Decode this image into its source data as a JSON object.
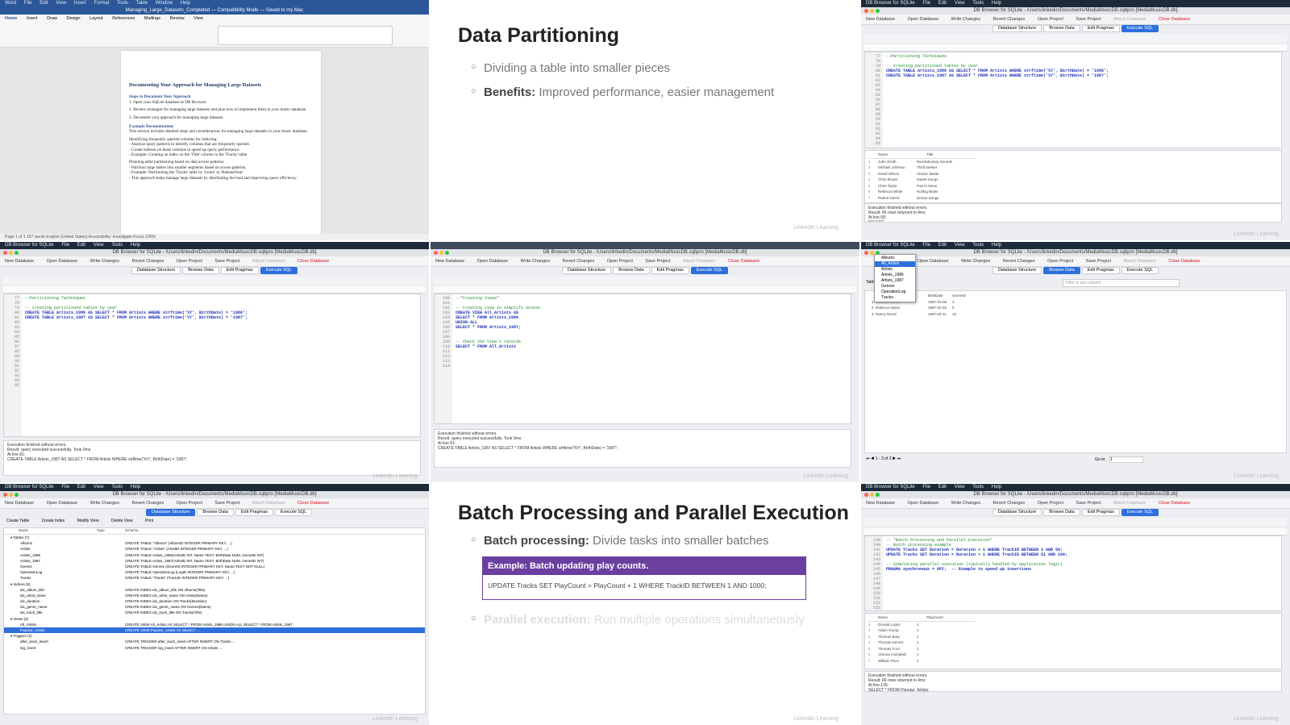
{
  "app": {
    "mac_menu": [
      "DB Browser for SQLite",
      "File",
      "Edit",
      "View",
      "Tools",
      "Help"
    ],
    "window_title": "DB Browser for SQLite - /Users/linkedin/Documents/MediaMusicDB.sqbpro [MediaMusicDB.db]",
    "toolbar": [
      "New Database",
      "Open Database",
      "Write Changes",
      "Revert Changes",
      "Open Project",
      "Save Project",
      "Attach Database",
      "Close Database"
    ],
    "tabs": [
      "Database Structure",
      "Browse Data",
      "Edit Pragmas",
      "Execute SQL"
    ],
    "watermark": "LinkedIn Learning"
  },
  "word": {
    "menu": [
      "Word",
      "File",
      "Edit",
      "View",
      "Insert",
      "Format",
      "Tools",
      "Table",
      "Window",
      "Help"
    ],
    "title": "Managing_Large_Datasets_Completed — Compatibility Mode — Saved to my Mac",
    "ribbon_tabs": [
      "Home",
      "Insert",
      "Draw",
      "Design",
      "Layout",
      "References",
      "Mailings",
      "Review",
      "View"
    ],
    "doc_title": "Documenting Your Approach for Managing Large Datasets",
    "doc_lines": [
      "Steps to Document Your Approach",
      "1. Open your SQLite database in DB Browser.",
      "2. Review strategies for managing large datasets and plan how to implement them in your music database.",
      "3. Document your approach for managing large datasets.",
      "Example Documentation",
      "This section includes detailed steps and considerations for managing large datasets in your music database.",
      "Identifying frequently queried columns for indexing:",
      "- Analyze query patterns to identify columns that are frequently queried.",
      "- Create indexes on these columns to speed up query performance.",
      "- Example: Creating an index on the 'Title' column in the 'Tracks' table.",
      "Planning table partitioning based on data access patterns:",
      "- Partition large tables into smaller segments based on access patterns.",
      "- Example: Partitioning the 'Tracks' table by 'Genre' or 'ReleaseYear'.",
      "- This approach helps manage large datasets by distributing the load and improving query efficiency."
    ],
    "status": "Page 1 of 1    167 words    English (United States)    Accessibility: Investigate    Focus    100%"
  },
  "slide1": {
    "title": "Data Partitioning",
    "bullet1": "Dividing a table into smaller pieces",
    "bullet2_label": "Benefits:",
    "bullet2_text": "Improved performance, easier management"
  },
  "slide2": {
    "title": "Batch Processing and Parallel Execution",
    "bullet1_label": "Batch processing:",
    "bullet1_text": "Divide tasks into smaller batches",
    "example_title": "Example: Batch updating play counts.",
    "example_code": "UPDATE Tracks SET PlayCount = PlayCount + 1 WHERE TrackID BETWEEN 1 AND 1000;",
    "bullet2_label": "Parallel execution:",
    "bullet2_text": "Run multiple operations simultaneously"
  },
  "editor_tr": {
    "lines": [
      "77",
      "78",
      "79",
      "80",
      "81",
      "82",
      "83",
      "84",
      "85",
      "86",
      "87",
      "88",
      "89",
      "90",
      "91",
      "92",
      "93",
      "94",
      "95"
    ],
    "code": [
      {
        "t": "c",
        "v": "--Partitioning Techniques"
      },
      {
        "t": "",
        "v": ""
      },
      {
        "t": "c",
        "v": "-- Creating partitioned tables by year"
      },
      {
        "t": "k",
        "v": "CREATE TABLE Artists_1986 AS SELECT * FROM Artists WHERE strftime('%Y', BirthDate) = '1986';"
      },
      {
        "t": "k",
        "v": "CREATE TABLE Artists_1987 AS SELECT * FROM Artists WHERE strftime('%Y', BirthDate) = '1987';"
      }
    ],
    "result_cols": [
      "Name",
      "Title"
    ],
    "result_rows": [
      [
        "John Smith",
        "Revolutionary Sounds"
      ],
      [
        "Michael Johnson",
        "Thrill Seeker"
      ],
      [
        "David Wilson",
        "Classic Beats"
      ],
      [
        "Chris Brown",
        "Sweet Songs"
      ],
      [
        "Chris Taylor",
        "Pop to Move"
      ],
      [
        "Rebecca White",
        "Rolling Beats"
      ],
      [
        "Robert Harris",
        "Dream Songs"
      ]
    ],
    "message": "Execution finished without errors.\nResult: 66 rows returned in 4ms\nAt line 68:\nSELECT\n            Artists.Name,"
  },
  "editor_ml": {
    "lines": [
      "77",
      "78",
      "79",
      "80",
      "81",
      "82",
      "83",
      "84",
      "85",
      "86",
      "87",
      "88",
      "89",
      "90",
      "91",
      "92",
      "93",
      "94",
      "95"
    ],
    "code": [
      {
        "t": "c",
        "v": "--Partitioning Techniques"
      },
      {
        "t": "",
        "v": ""
      },
      {
        "t": "c",
        "v": "-- Creating partitioned tables by year"
      },
      {
        "t": "k",
        "v": "CREATE TABLE Artists_1986 AS SELECT * FROM Artists WHERE strftime('%Y', BirthDate) = '1986';"
      },
      {
        "t": "k",
        "v": "CREATE TABLE Artists_1987 AS SELECT * FROM Artists WHERE strftime('%Y', BirthDate) = '1987';"
      }
    ],
    "message": "Execution finished without errors.\nResult: query executed successfully. Took 0ms\nAt line 81:\nCREATE TABLE Artists_1987 AS SELECT * FROM Artists WHERE strftime('%Y', BirthDate) = '1987';"
  },
  "editor_mc": {
    "lines": [
      "100",
      "101",
      "102",
      "103",
      "104",
      "105",
      "106",
      "107",
      "108",
      "109",
      "110",
      "111",
      "112",
      "113",
      "114"
    ],
    "code": [
      {
        "t": "c",
        "v": "--\"Creating Views\""
      },
      {
        "t": "",
        "v": ""
      },
      {
        "t": "c",
        "v": "-- Creating view to simplify access"
      },
      {
        "t": "k",
        "v": "CREATE VIEW All_Artists AS"
      },
      {
        "t": "k",
        "v": "SELECT * FROM Artists_1986"
      },
      {
        "t": "k",
        "v": "UNION ALL"
      },
      {
        "t": "k",
        "v": "SELECT * FROM Artists_1987;"
      },
      {
        "t": "",
        "v": ""
      },
      {
        "t": "",
        "v": ""
      },
      {
        "t": "c",
        "v": "-- Check the View's records"
      },
      {
        "t": "k",
        "v": "SELECT * FROM All_Artists"
      }
    ],
    "message": "Execution finished without errors.\nResult: query executed successfully. Took 0ms\nAt line 81:\nCREATE TABLE Artists_1987 AS SELECT * FROM Artists WHERE strftime('%Y', BirthDate) = '1987';"
  },
  "browse_mr": {
    "table_label": "Table:",
    "tables": [
      "Albums",
      "All_Artists",
      "Artists",
      "Artists_1986",
      "Artists_1987",
      "Genres",
      "OperationLog",
      "Tracks"
    ],
    "filter_placeholder": "Filter in any column",
    "cols": [
      "",
      "BirthDate",
      "GenreID"
    ],
    "rows": [
      [
        "1  Amanda White",
        "1987-01-08",
        "3"
      ],
      [
        "2  Rebecca Ward",
        "1987-02-26",
        "5"
      ],
      [
        "3  Nancy Wood",
        "1987-03-11",
        "10"
      ]
    ],
    "pager": "1 - 3 of 3",
    "goto_label": "Go to:",
    "goto_value": "1"
  },
  "structure_bl": {
    "buttons": [
      "Create Table",
      "Create Index",
      "Modify View",
      "Delete View",
      "Print"
    ],
    "cols": [
      "Name",
      "Type",
      "Schema"
    ],
    "rows": [
      [
        "Tables (7)",
        "",
        ""
      ],
      [
        "Albums",
        "",
        "CREATE TABLE \"Albums\" (AlbumID INTEGER PRIMARY KEY, ...)"
      ],
      [
        "Artists",
        "",
        "CREATE TABLE \"Artists\" (ArtistID INTEGER PRIMARY KEY, ...)"
      ],
      [
        "Artists_1986",
        "",
        "CREATE TABLE Artists_1986(ArtistID INT, Name TEXT, BirthDate NUM, GenreID INT)"
      ],
      [
        "Artists_1987",
        "",
        "CREATE TABLE Artists_1987(ArtistID INT, Name TEXT, BirthDate NUM, GenreID INT)"
      ],
      [
        "Genres",
        "",
        "CREATE TABLE Genres (GenreID INTEGER PRIMARY KEY, Name TEXT NOT NULL)"
      ],
      [
        "OperationLog",
        "",
        "CREATE TABLE OperationLog (LogID INTEGER PRIMARY KEY, ...)"
      ],
      [
        "Tracks",
        "",
        "CREATE TABLE \"Tracks\" (TrackID INTEGER PRIMARY KEY, ...)"
      ],
      [
        "Indices (5)",
        "",
        ""
      ],
      [
        "idx_album_title",
        "",
        "CREATE INDEX idx_album_title ON Albums(Title)"
      ],
      [
        "idx_artist_name",
        "",
        "CREATE INDEX idx_artist_name ON Artists(Name)"
      ],
      [
        "idx_duration",
        "",
        "CREATE INDEX idx_duration ON Tracks(Duration)"
      ],
      [
        "idx_genre_name",
        "",
        "CREATE INDEX idx_genre_name ON Genres(Name)"
      ],
      [
        "idx_track_title",
        "",
        "CREATE INDEX idx_track_title ON Tracks(Title)"
      ],
      [
        "Views (2)",
        "",
        ""
      ],
      [
        "All_Artists",
        "",
        "CREATE VIEW All_Artists AS SELECT * FROM Artists_1986 UNION ALL SELECT * FROM Artists_1987"
      ],
      [
        "Popular_Artists",
        "",
        "CREATE VIEW Popular_Artists AS SELECT ..."
      ],
      [
        "Triggers (2)",
        "",
        ""
      ],
      [
        "after_track_insert",
        "",
        "CREATE TRIGGER after_track_insert AFTER INSERT ON Tracks ..."
      ],
      [
        "log_insert",
        "",
        "CREATE TRIGGER log_insert AFTER INSERT ON Artists ..."
      ]
    ]
  },
  "editor_br": {
    "lines": [
      "139",
      "140",
      "141",
      "142",
      "143",
      "144",
      "145",
      "146",
      "147",
      "148",
      "149",
      "150",
      "151",
      "152",
      "153"
    ],
    "code": [
      {
        "t": "c",
        "v": "-- \"Batch Processing and Parallel Execution\""
      },
      {
        "t": "c",
        "v": "-- Batch processing example"
      },
      {
        "t": "k",
        "v": "UPDATE Tracks SET Duration = Duration + 1 WHERE TrackID BETWEEN 1 AND 50;"
      },
      {
        "t": "k",
        "v": "UPDATE Tracks SET Duration = Duration + 1 WHERE TrackID BETWEEN 51 AND 100;"
      },
      {
        "t": "",
        "v": ""
      },
      {
        "t": "c",
        "v": "-- Simulating parallel execution (typically handled by application logic)"
      },
      {
        "t": "k",
        "v": "PRAGMA synchronous = OFF;  -- Example to speed up insertions"
      }
    ],
    "result_cols": [
      "Name",
      "PlayCount"
    ],
    "result_rows": [
      [
        "Donald Lopez",
        "1"
      ],
      [
        "Adam Young",
        "1"
      ],
      [
        "Thomas Bray",
        "1"
      ],
      [
        "Thomas Dennis",
        "1"
      ],
      [
        "Thomas Ford",
        "1"
      ],
      [
        "Victoria Campbell",
        "1"
      ],
      [
        "William Price",
        "1"
      ]
    ],
    "message": "Execution finished without errors.\nResult: 66 rows returned in 4ms\nAt line 135:\nSELECT * FROM Popular_Artists;"
  }
}
